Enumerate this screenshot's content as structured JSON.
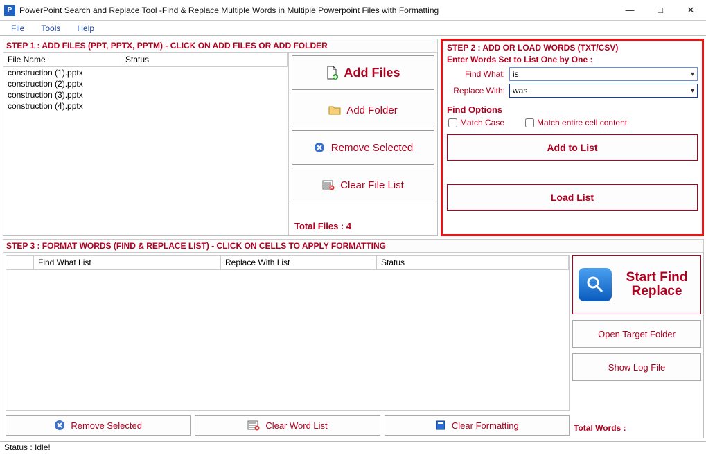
{
  "window": {
    "title": "PowerPoint Search and Replace Tool -Find & Replace Multiple Words in Multiple Powerpoint Files with Formatting"
  },
  "menu": {
    "file": "File",
    "tools": "Tools",
    "help": "Help"
  },
  "step1": {
    "header": "STEP 1 : ADD FILES (PPT, PPTX, PPTM) - CLICK ON ADD FILES OR ADD FOLDER",
    "columns": {
      "file": "File Name",
      "status": "Status"
    },
    "rows": [
      {
        "file": "construction (1).pptx",
        "status": ""
      },
      {
        "file": "construction (2).pptx",
        "status": ""
      },
      {
        "file": "construction (3).pptx",
        "status": ""
      },
      {
        "file": "construction (4).pptx",
        "status": ""
      }
    ],
    "buttons": {
      "add_files": "Add Files",
      "add_folder": "Add Folder",
      "remove_selected": "Remove Selected",
      "clear_list": "Clear File List"
    },
    "total_label": "Total Files : 4"
  },
  "step2": {
    "header": "STEP 2 : ADD OR LOAD WORDS (TXT/CSV)",
    "sub": "Enter Words Set to List One by One :",
    "find_label": "Find What:",
    "find_value": "is",
    "replace_label": "Replace With:",
    "replace_value": "was",
    "find_options": "Find Options",
    "match_case": "Match Case",
    "match_entire": "Match entire cell content",
    "add_to_list": "Add to List",
    "load_list": "Load List"
  },
  "step3": {
    "header": "STEP 3 : FORMAT WORDS (FIND & REPLACE LIST) - CLICK ON CELLS TO APPLY FORMATTING",
    "columns": {
      "find": "Find What List",
      "replace": "Replace With List",
      "status": "Status"
    },
    "start": "Start Find Replace",
    "open_target": "Open Target Folder",
    "show_log": "Show Log File",
    "total_words": "Total Words :",
    "remove_selected": "Remove Selected",
    "clear_word": "Clear Word List",
    "clear_format": "Clear Formatting"
  },
  "status": "Status  :  Idle!"
}
